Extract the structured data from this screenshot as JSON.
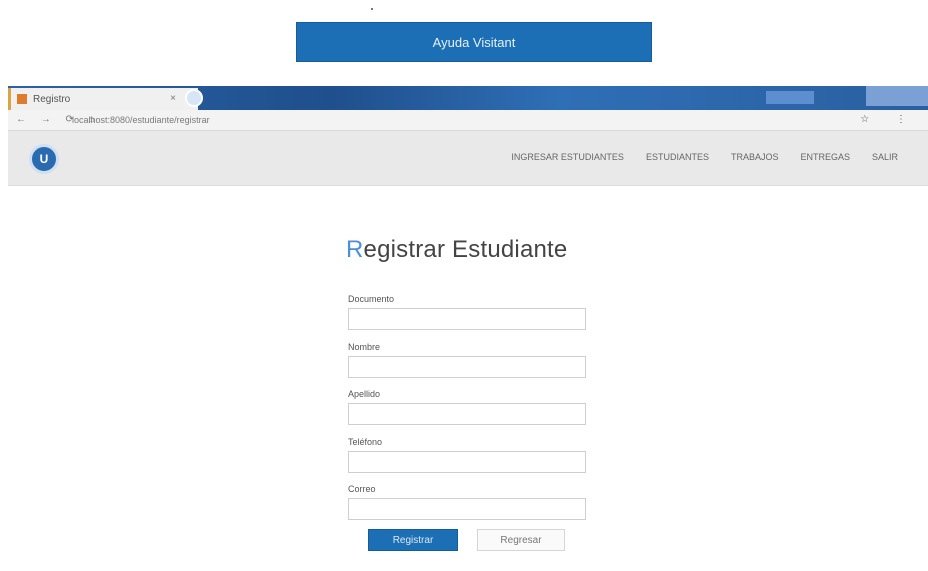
{
  "banner": {
    "label": "Ayuda Visitant"
  },
  "browser": {
    "tab_title": "Registro",
    "tab_close": "×",
    "window_title": "",
    "url": "localhost:8080/estudiante/registrar",
    "nav_icons": "← → ⟳ ⌂",
    "right_icons": "☆ ⋮"
  },
  "site": {
    "logo_text": "U",
    "nav": [
      "INGRESAR ESTUDIANTES",
      "ESTUDIANTES",
      "TRABAJOS",
      "ENTREGAS",
      "SALIR"
    ]
  },
  "form": {
    "title_first": "R",
    "title_rest": "egistrar Estudiante",
    "fields": [
      {
        "label": "Documento",
        "value": ""
      },
      {
        "label": "Nombre",
        "value": ""
      },
      {
        "label": "Apellido",
        "value": ""
      },
      {
        "label": "Teléfono",
        "value": ""
      },
      {
        "label": "Correo",
        "value": ""
      }
    ],
    "submit_label": "Registrar",
    "cancel_label": "Regresar"
  },
  "colors": {
    "accent": "#1c6fb5",
    "nav_bg": "#e9e9e9",
    "titlebar": "#2b63a7"
  }
}
